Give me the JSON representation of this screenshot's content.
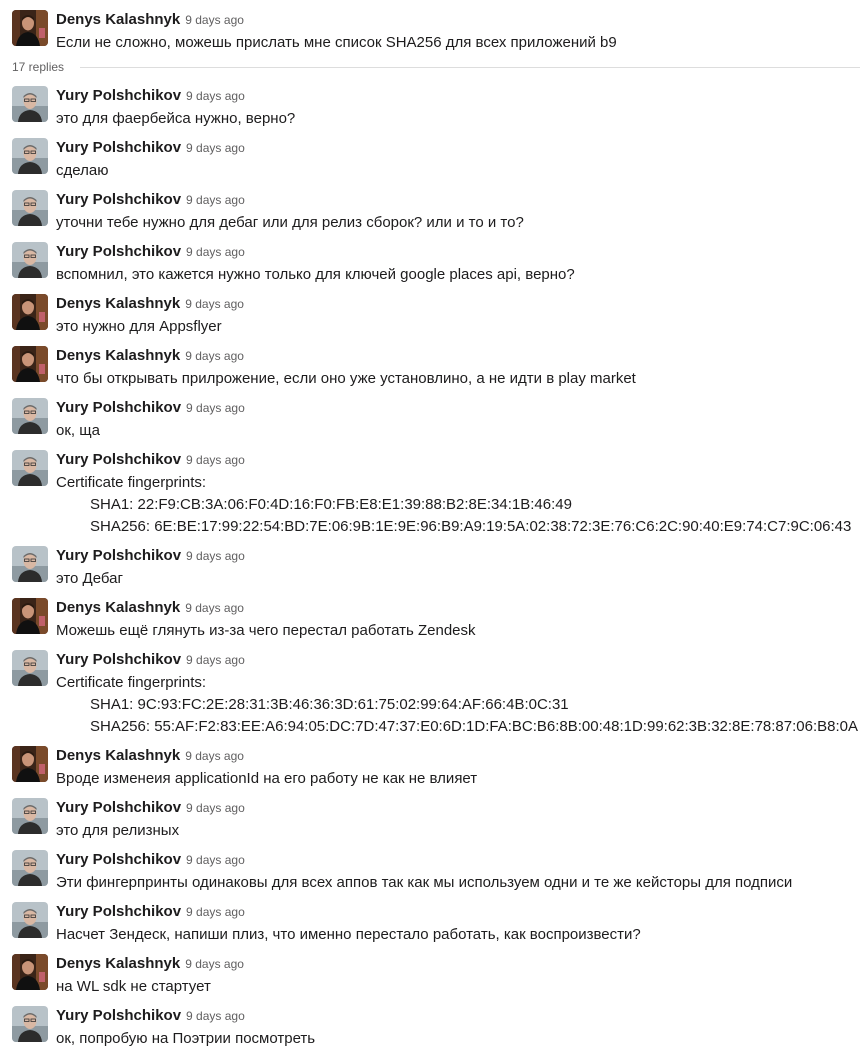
{
  "parent": {
    "author": "Denys Kalashnyk",
    "avatar": "denys",
    "time": "9 days ago",
    "lines": [
      "Если не сложно, можешь прислать мне список SHA256 для всех приложений b9"
    ]
  },
  "replies_label": "17 replies",
  "replies": [
    {
      "author": "Yury Polshchikov",
      "avatar": "yury",
      "time": "9 days ago",
      "lines": [
        "это для фаербейса нужно, верно?"
      ]
    },
    {
      "author": "Yury Polshchikov",
      "avatar": "yury",
      "time": "9 days ago",
      "lines": [
        "сделаю"
      ]
    },
    {
      "author": "Yury Polshchikov",
      "avatar": "yury",
      "time": "9 days ago",
      "lines": [
        "уточни тебе нужно для дебаг или для релиз сборок? или и то и то?"
      ]
    },
    {
      "author": "Yury Polshchikov",
      "avatar": "yury",
      "time": "9 days ago",
      "lines": [
        "вспомнил, это кажется нужно только для ключей google places api, верно?"
      ]
    },
    {
      "author": "Denys Kalashnyk",
      "avatar": "denys",
      "time": "9 days ago",
      "lines": [
        "это нужно для Appsflyer"
      ]
    },
    {
      "author": "Denys Kalashnyk",
      "avatar": "denys",
      "time": "9 days ago",
      "lines": [
        "что бы открывать прилрожение, если оно уже установлино, а не идти в play market"
      ]
    },
    {
      "author": "Yury Polshchikov",
      "avatar": "yury",
      "time": "9 days ago",
      "lines": [
        "ок, ща"
      ]
    },
    {
      "author": "Yury Polshchikov",
      "avatar": "yury",
      "time": "9 days ago",
      "lines": [
        "Certificate fingerprints:",
        "SHA1: 22:F9:CB:3A:06:F0:4D:16:F0:FB:E8:E1:39:88:B2:8E:34:1B:46:49",
        "SHA256: 6E:BE:17:99:22:54:BD:7E:06:9B:1E:9E:96:B9:A9:19:5A:02:38:72:3E:76:C6:2C:90:40:E9:74:C7:9C:06:43"
      ]
    },
    {
      "author": "Yury Polshchikov",
      "avatar": "yury",
      "time": "9 days ago",
      "lines": [
        "это Дебаг"
      ]
    },
    {
      "author": "Denys Kalashnyk",
      "avatar": "denys",
      "time": "9 days ago",
      "lines": [
        "Можешь ещё глянуть из-за чего перестал работать Zendesk"
      ]
    },
    {
      "author": "Yury Polshchikov",
      "avatar": "yury",
      "time": "9 days ago",
      "lines": [
        "Certificate fingerprints:",
        "SHA1: 9C:93:FC:2E:28:31:3B:46:36:3D:61:75:02:99:64:AF:66:4B:0C:31",
        "SHA256: 55:AF:F2:83:EE:A6:94:05:DC:7D:47:37:E0:6D:1D:FA:BC:B6:8B:00:48:1D:99:62:3B:32:8E:78:87:06:B8:0A"
      ]
    },
    {
      "author": "Denys Kalashnyk",
      "avatar": "denys",
      "time": "9 days ago",
      "lines": [
        "Вроде изменеия applicationId на его работу не как не влияет"
      ]
    },
    {
      "author": "Yury Polshchikov",
      "avatar": "yury",
      "time": "9 days ago",
      "lines": [
        "это для релизных"
      ]
    },
    {
      "author": "Yury Polshchikov",
      "avatar": "yury",
      "time": "9 days ago",
      "lines": [
        "Эти фингерпринты одинаковы для всех аппов так как мы используем одни и те же кейсторы для подписи"
      ]
    },
    {
      "author": "Yury Polshchikov",
      "avatar": "yury",
      "time": "9 days ago",
      "lines": [
        "Насчет Зендеск, напиши плиз, что именно перестало работать, как воспроизвести?"
      ]
    },
    {
      "author": "Denys Kalashnyk",
      "avatar": "denys",
      "time": "9 days ago",
      "lines": [
        "на WL sdk не стартует"
      ]
    },
    {
      "author": "Yury Polshchikov",
      "avatar": "yury",
      "time": "9 days ago",
      "lines": [
        "ок, попробую на Поэтрии посмотреть"
      ]
    }
  ]
}
